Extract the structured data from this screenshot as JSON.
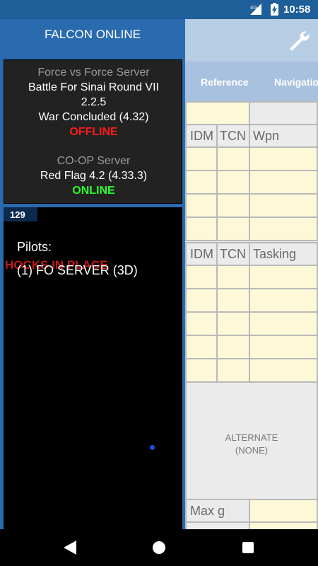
{
  "status_bar": {
    "network": "4G",
    "time": "10:58"
  },
  "background_app": {
    "tabs": [
      "Reference",
      "Navigation"
    ],
    "tables": {
      "waypoints": {
        "headers": [
          "IDM",
          "TCN",
          "Wpn"
        ]
      },
      "tasking": {
        "headers": [
          "IDM",
          "TCN",
          "Tasking"
        ]
      }
    },
    "alternate": {
      "line1": "ALTERNATE",
      "line2": "(NONE)"
    },
    "max_g_label": "Max g"
  },
  "drawer": {
    "title": "FALCON ONLINE",
    "force_server": {
      "heading": "Force vs Force Server",
      "name": "Battle For Sinai Round VII",
      "version": "2.2.5",
      "state": "War Concluded (4.32)",
      "status": "OFFLINE"
    },
    "coop_server": {
      "heading": "CO-OP Server",
      "name": "Red Flag 4.2 (4.33.3)",
      "status": "ONLINE"
    },
    "pilot_panel": {
      "badge": "129",
      "pilots_label": "Pilots:",
      "overlay_text": "HOCKS IN PLACE",
      "entries": [
        "(1) FO SERVER (3D)"
      ]
    }
  },
  "colors": {
    "drawer_blue": "#2a6bb0",
    "status_offline": "#ff1a1a",
    "status_online": "#2bff2b",
    "status_bar": "#1e5e99"
  }
}
